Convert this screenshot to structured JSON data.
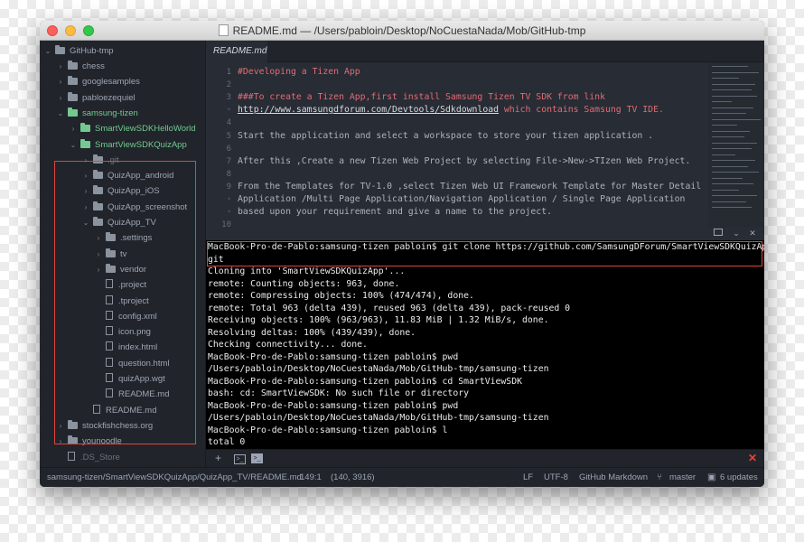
{
  "window": {
    "title": "README.md — /Users/pabloin/Desktop/NoCuestaNada/Mob/GitHub-tmp"
  },
  "sidebar": {
    "root": "GitHub-tmp",
    "items": [
      {
        "label": "chess",
        "kind": "folder",
        "chevron": "›"
      },
      {
        "label": "googlesamples",
        "kind": "folder",
        "chevron": "›"
      },
      {
        "label": "pabloezequiel",
        "kind": "folder",
        "chevron": "›"
      },
      {
        "label": "samsung-tizen",
        "kind": "folder",
        "chevron": "⌄"
      },
      {
        "label": "SmartViewSDKHelloWorld",
        "kind": "folder",
        "chevron": "›"
      },
      {
        "label": "SmartViewSDKQuizApp",
        "kind": "folder",
        "chevron": "⌄"
      },
      {
        "label": ".git",
        "kind": "folder",
        "chevron": "›"
      },
      {
        "label": "QuizApp_android",
        "kind": "folder",
        "chevron": "›"
      },
      {
        "label": "QuizApp_iOS",
        "kind": "folder",
        "chevron": "›"
      },
      {
        "label": "QuizApp_screenshot",
        "kind": "folder",
        "chevron": "›"
      },
      {
        "label": "QuizApp_TV",
        "kind": "folder",
        "chevron": "⌄"
      },
      {
        "label": ".settings",
        "kind": "folder",
        "chevron": "›"
      },
      {
        "label": "tv",
        "kind": "folder",
        "chevron": "›"
      },
      {
        "label": "vendor",
        "kind": "folder",
        "chevron": "›"
      },
      {
        "label": ".project",
        "kind": "file"
      },
      {
        "label": ".tproject",
        "kind": "file"
      },
      {
        "label": "config.xml",
        "kind": "file"
      },
      {
        "label": "icon.png",
        "kind": "file"
      },
      {
        "label": "index.html",
        "kind": "file"
      },
      {
        "label": "question.html",
        "kind": "file"
      },
      {
        "label": "quizApp.wgt",
        "kind": "file"
      },
      {
        "label": "README.md",
        "kind": "file"
      },
      {
        "label": "README.md",
        "kind": "file"
      },
      {
        "label": "stockfishchess.org",
        "kind": "folder",
        "chevron": "›"
      },
      {
        "label": "younoodle",
        "kind": "folder",
        "chevron": "›"
      },
      {
        "label": ".DS_Store",
        "kind": "file"
      }
    ]
  },
  "tabs": [
    {
      "label": "README.md"
    }
  ],
  "editor": {
    "lines": [
      {
        "num": "1",
        "text": "#Developing a Tizen App"
      },
      {
        "num": "2",
        "text": ""
      },
      {
        "num": "3",
        "text": "###To create a Tizen App,first install Samsung Tizen TV SDK  from link"
      },
      {
        "num": "•",
        "text": "http://www.samsungdforum.com/Devtools/Sdkdownload",
        "after": " which contains Samsung TV IDE."
      },
      {
        "num": "4",
        "text": ""
      },
      {
        "num": "5",
        "text": "Start the application and select a workspace to store your tizen application ."
      },
      {
        "num": "6",
        "text": ""
      },
      {
        "num": "7",
        "text": "After this ,Create a new Tizen Web Project by selecting File->New->TIzen Web Project."
      },
      {
        "num": "8",
        "text": ""
      },
      {
        "num": "9",
        "text": "From the Templates for TV-1.0 ,select Tizen Web UI Framework  Template for  Master Detail"
      },
      {
        "num": "•",
        "text": "Application /Multi Page Application/Navigation Application / Single Page Application"
      },
      {
        "num": "•",
        "text": "based upon your requirement and give a name to the project."
      },
      {
        "num": "10",
        "text": ""
      }
    ]
  },
  "terminal": {
    "lines": [
      "MacBook-Pro-de-Pablo:samsung-tizen pabloin$ git clone https://github.com/SamsungDForum/SmartViewSDKQuizApp.",
      "git",
      "Cloning into 'SmartViewSDKQuizApp'...",
      "remote: Counting objects: 963, done.",
      "remote: Compressing objects: 100% (474/474), done.",
      "remote: Total 963 (delta 439), reused 963 (delta 439), pack-reused 0",
      "Receiving objects: 100% (963/963), 11.83 MiB | 1.32 MiB/s, done.",
      "Resolving deltas: 100% (439/439), done.",
      "Checking connectivity... done.",
      "MacBook-Pro-de-Pablo:samsung-tizen pabloin$ pwd",
      "/Users/pabloin/Desktop/NoCuestaNada/Mob/GitHub-tmp/samsung-tizen",
      "MacBook-Pro-de-Pablo:samsung-tizen pabloin$ cd SmartViewSDK",
      "bash: cd: SmartViewSDK: No such file or directory",
      "MacBook-Pro-de-Pablo:samsung-tizen pabloin$ pwd",
      "/Users/pabloin/Desktop/NoCuestaNada/Mob/GitHub-tmp/samsung-tizen",
      "MacBook-Pro-de-Pablo:samsung-tizen pabloin$ l",
      "total 0"
    ]
  },
  "status": {
    "path": "samsung-tizen/SmartViewSDKQuizApp/QuizApp_TV/README.md",
    "cursor": "149:1",
    "selection": "(140, 3916)",
    "line_ending": "LF",
    "encoding": "UTF-8",
    "grammar": "GitHub Markdown",
    "branch": "master",
    "updates": "6 updates"
  },
  "colors": {
    "highlight_box": "#e0443a",
    "git_added": "#73c990",
    "background": "#282c34"
  }
}
